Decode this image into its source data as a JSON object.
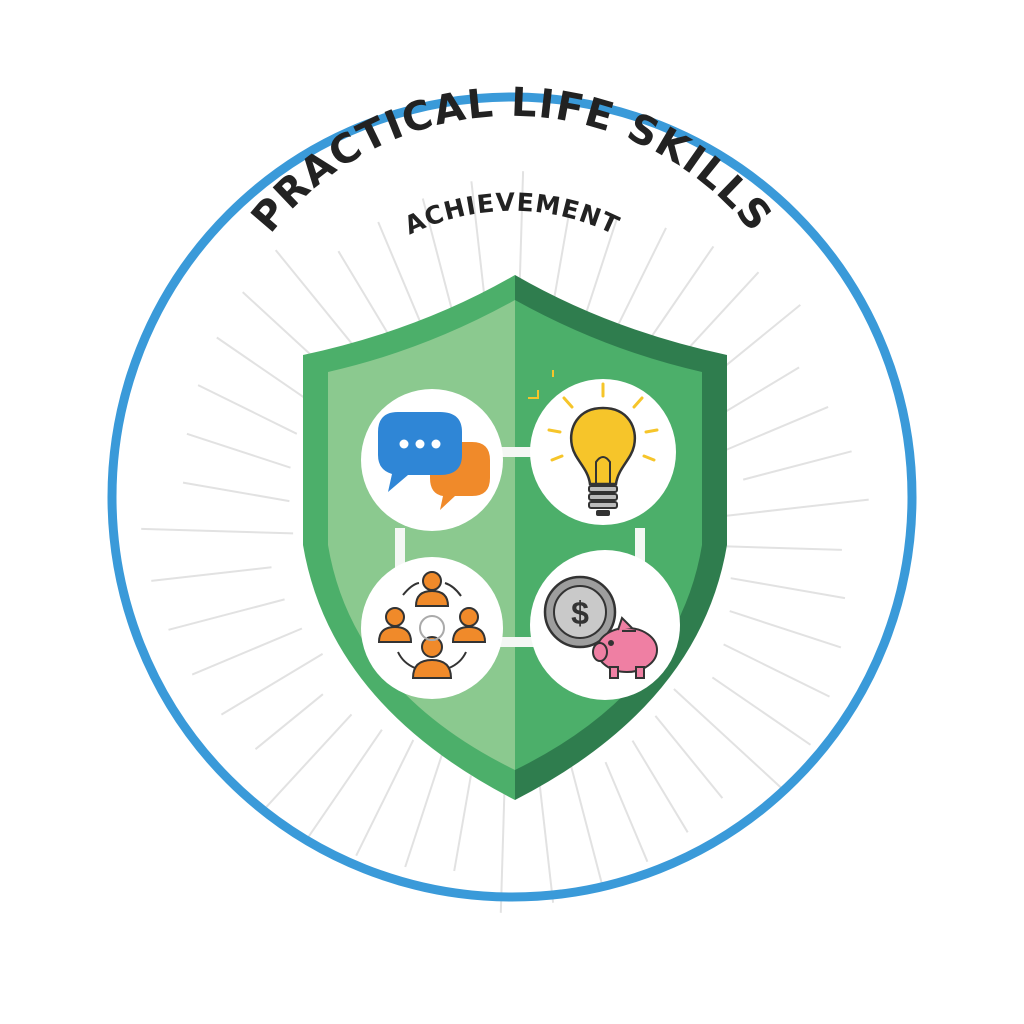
{
  "badge": {
    "title": "PRACTICAL LIFE SKILLS",
    "subtitle": "ACHIEVEMENT",
    "colors": {
      "ring": "#3a9ad9",
      "shield_dark": "#2f7d4e",
      "shield_mid": "#4caf6a",
      "shield_light": "#8bc98f",
      "rays": "#e2e2e2",
      "connector": "#f4f7f4",
      "chat_blue": "#2f86d6",
      "chat_orange": "#f08a2a",
      "bulb_yellow": "#f6c52a",
      "people_orange": "#f08a2a",
      "coin_gray": "#9e9e9e",
      "piggy_pink": "#ef7fa3"
    },
    "icons": [
      {
        "name": "speech-bubbles-icon",
        "meaning": "communication"
      },
      {
        "name": "lightbulb-icon",
        "meaning": "ideas"
      },
      {
        "name": "team-network-icon",
        "meaning": "teamwork"
      },
      {
        "name": "money-savings-icon",
        "meaning": "finance"
      }
    ],
    "coin_symbol": "$"
  }
}
